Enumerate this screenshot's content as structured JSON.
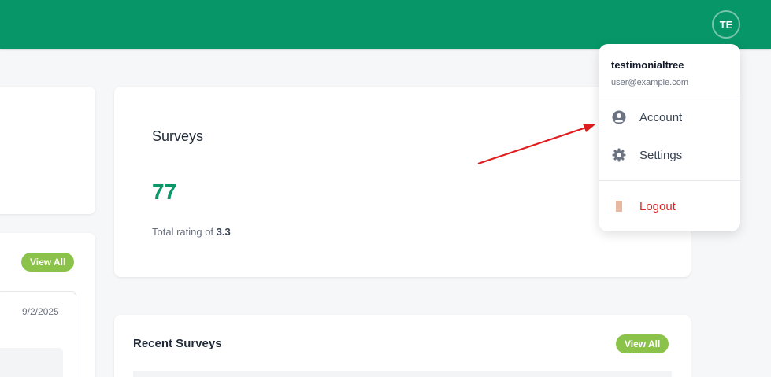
{
  "header": {
    "avatar_initials": "TE",
    "bg_color": "#069668"
  },
  "left_panel": {
    "view_all_label": "View All",
    "date": "9/2/2025"
  },
  "surveys_card": {
    "title": "Surveys",
    "count": "77",
    "rating_prefix": "Total rating of",
    "rating_value": "3.3"
  },
  "recent_surveys": {
    "title": "Recent Surveys",
    "view_all_label": "View All"
  },
  "user_menu": {
    "username": "testimonialtree",
    "email": "user@example.com",
    "items": [
      {
        "label": "Account",
        "icon": "user-circle-icon"
      },
      {
        "label": "Settings",
        "icon": "gear-icon"
      },
      {
        "label": "Logout",
        "icon": "logout-icon"
      }
    ]
  },
  "colors": {
    "accent": "#8bc34a",
    "count": "#0d9668",
    "logout": "#dc2626",
    "annotation_arrow": "#e01c1c"
  }
}
